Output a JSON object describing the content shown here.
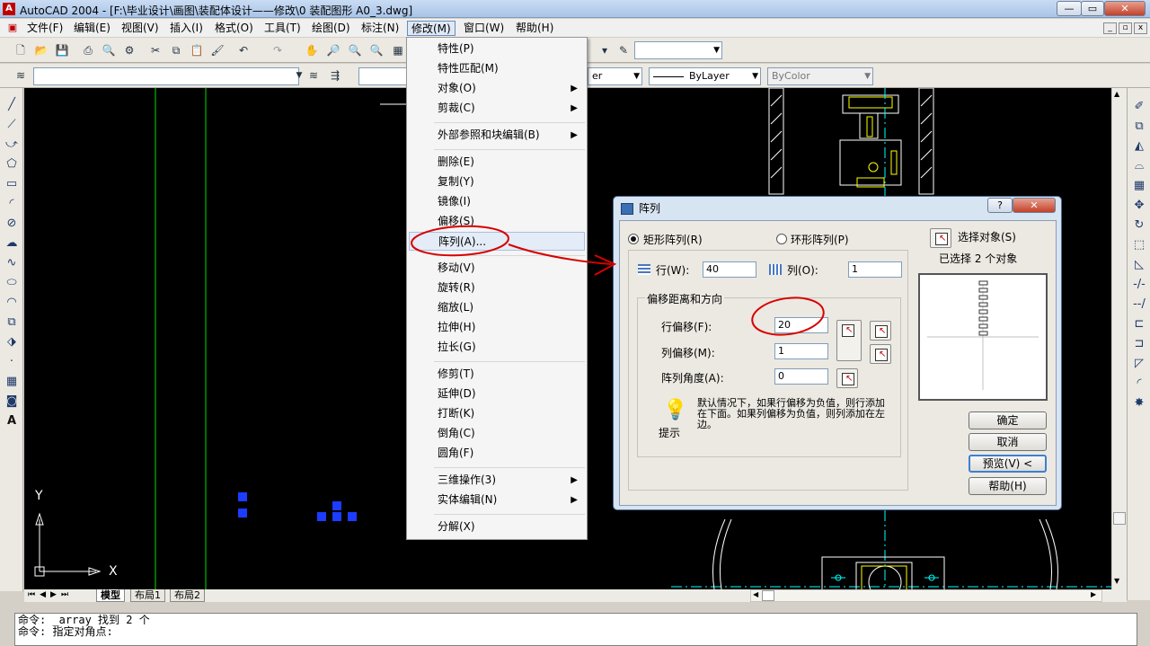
{
  "window": {
    "title": "AutoCAD 2004 - [F:\\毕业设计\\画图\\装配体设计——修改\\0 装配图形 A0_3.dwg]",
    "minimize": "—",
    "maximize": "▭",
    "close": "✕"
  },
  "menubar": {
    "items": [
      "文件(F)",
      "编辑(E)",
      "视图(V)",
      "插入(I)",
      "格式(O)",
      "工具(T)",
      "绘图(D)",
      "标注(N)",
      "修改(M)",
      "窗口(W)",
      "帮助(H)"
    ],
    "doc_min": "_",
    "doc_restore": "▫",
    "doc_close": "x"
  },
  "toolbar": {
    "layer_combo": "",
    "color_combo": "ByColor",
    "linetype_combo_suffix": "er",
    "lineweight_combo": "ByLayer"
  },
  "modify_menu": {
    "items": [
      {
        "label": "特性(P)"
      },
      {
        "label": "特性匹配(M)"
      },
      {
        "label": "对象(O)",
        "submenu": true
      },
      {
        "label": "剪裁(C)",
        "submenu": true
      },
      {
        "label": "外部参照和块编辑(B)",
        "submenu": true
      },
      {
        "label": "删除(E)"
      },
      {
        "label": "复制(Y)"
      },
      {
        "label": "镜像(I)"
      },
      {
        "label": "偏移(S)"
      },
      {
        "label": "阵列(A)..."
      },
      {
        "label": "移动(V)"
      },
      {
        "label": "旋转(R)"
      },
      {
        "label": "缩放(L)"
      },
      {
        "label": "拉伸(H)"
      },
      {
        "label": "拉长(G)"
      },
      {
        "label": "修剪(T)"
      },
      {
        "label": "延伸(D)"
      },
      {
        "label": "打断(K)"
      },
      {
        "label": "倒角(C)"
      },
      {
        "label": "圆角(F)"
      },
      {
        "label": "三维操作(3)",
        "submenu": true
      },
      {
        "label": "实体编辑(N)",
        "submenu": true
      },
      {
        "label": "分解(X)"
      }
    ],
    "submenu_arrow": "▶"
  },
  "array_dialog": {
    "title": "阵列",
    "help_btn": "?",
    "close_btn": "✕",
    "rect_array": "矩形阵列(R)",
    "polar_array": "环形阵列(P)",
    "select_objects": "选择对象(S)",
    "selected_count": "已选择 2 个对象",
    "rows_label": "行(W):",
    "rows_value": "40",
    "cols_label": "列(O):",
    "cols_value": "1",
    "offset_group": "偏移距离和方向",
    "row_offset_label": "行偏移(F):",
    "row_offset_value": "20",
    "col_offset_label": "列偏移(M):",
    "col_offset_value": "1",
    "angle_label": "阵列角度(A):",
    "angle_value": "0",
    "tip_text": "默认情况下，如果行偏移为负值，则行添加在下面。如果列偏移为负值，则列添加在左边。",
    "tip_label": "提示",
    "ok": "确定",
    "cancel": "取消",
    "preview": "预览(V) <",
    "help": "帮助(H)"
  },
  "layout_tabs": [
    "模型",
    "布局1",
    "布局2"
  ],
  "ucs": {
    "x": "X",
    "y": "Y"
  },
  "command_line": [
    "命令: _array 找到 2 个",
    "命令: 指定对角点:"
  ],
  "colors": {
    "canvas": "#000000",
    "annotation": "#d80000",
    "grip": "#1c3cff"
  }
}
